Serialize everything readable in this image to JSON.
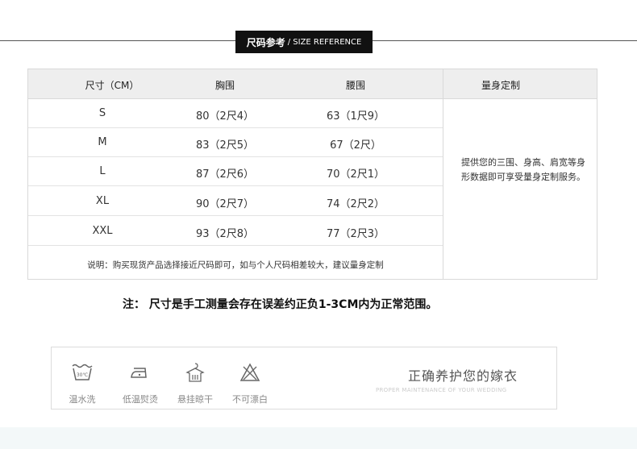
{
  "header": {
    "title_cn": "尺码参考",
    "title_en": "/ SIZE REFERENCE"
  },
  "table": {
    "columns": [
      "尺寸（CM）",
      "胸围",
      "腰围",
      "量身定制"
    ],
    "rows": [
      {
        "size": "S",
        "chest": "80（2尺4）",
        "waist": "63（1尺9）"
      },
      {
        "size": "M",
        "chest": "83（2尺5）",
        "waist": "67（2尺）"
      },
      {
        "size": "L",
        "chest": "87（2尺6）",
        "waist": "70（2尺1）"
      },
      {
        "size": "XL",
        "chest": "90（2尺7）",
        "waist": "74（2尺2）"
      },
      {
        "size": "XXL",
        "chest": "93（2尺8）",
        "waist": "77（2尺3）"
      }
    ],
    "note": "说明：购买现货产品选择接近尺码即可，如与个人尺码相差较大，建议量身定制",
    "custom_text": "提供您的三围、身高、肩宽等身形数据即可享受量身定制服务。"
  },
  "remark": "注： 尺寸是手工测量会存在误差约正负1-3CM内为正常范围。",
  "care": {
    "items": [
      {
        "icon": "wash-tub-icon",
        "label": "温水洗",
        "icon_text": "30℃"
      },
      {
        "icon": "iron-icon",
        "label": "低温熨烫"
      },
      {
        "icon": "hang-dry-icon",
        "label": "悬挂晾干"
      },
      {
        "icon": "no-bleach-icon",
        "label": "不可漂白"
      }
    ],
    "title": "正确养护您的嫁衣",
    "subtitle": "PROPER MAINTENANCE OF YOUR WEDDING"
  }
}
